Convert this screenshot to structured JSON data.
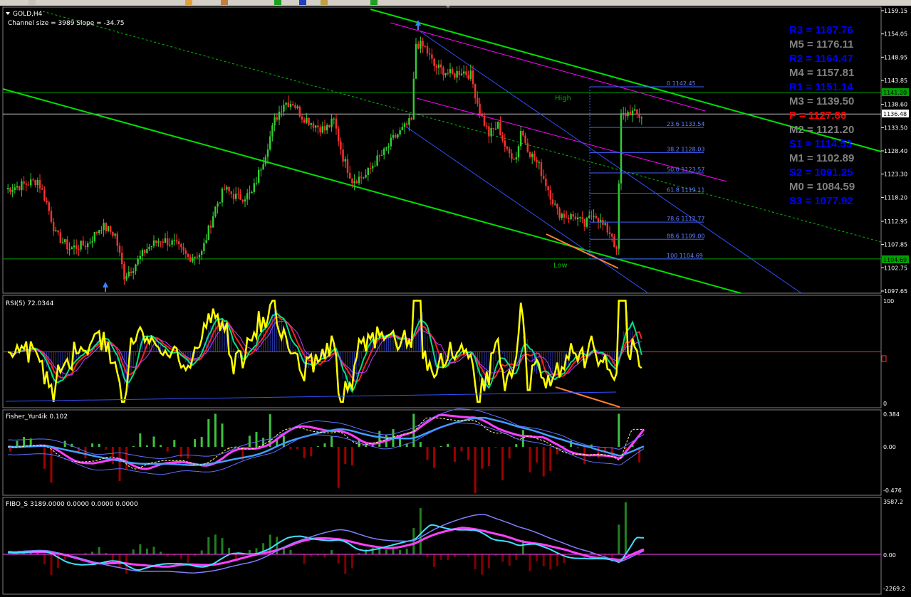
{
  "toolbar": {
    "buttons": [
      "tool-a",
      "tool-b",
      "tool-c",
      "tool-d",
      "tool-e",
      "tool-f",
      "tool-g"
    ]
  },
  "main": {
    "title": "GOLD,H4",
    "subtitle": "Channel size = 3989 Slope = -34.75",
    "price_labels": [
      "1159.15",
      "1154.05",
      "1148.95",
      "1143.85",
      "1138.60",
      "1133.50",
      "1128.40",
      "1123.30",
      "1118.20",
      "1112.95",
      "1107.85",
      "1102.75",
      "1097.65"
    ],
    "last_price": "1136.48",
    "high_price": "1141.20",
    "low_price": "1104.69",
    "high_label": "High",
    "low_label": "Low",
    "fib_levels": [
      {
        "label": "0 1142.45",
        "price": 1142.45
      },
      {
        "label": "23.6 1133.54",
        "price": 1133.54
      },
      {
        "label": "38.2 1128.03",
        "price": 1128.03
      },
      {
        "label": "50.0 1123.57",
        "price": 1123.57
      },
      {
        "label": "61.8 1119.11",
        "price": 1119.11
      },
      {
        "label": "78.6 1112.77",
        "price": 1112.77
      },
      {
        "label": "88.6 1109.00",
        "price": 1109.0
      },
      {
        "label": "100 1104.69",
        "price": 1104.69
      }
    ],
    "pivots": [
      {
        "label": "R3",
        "text": " = 1187.76",
        "color": "#0000ff"
      },
      {
        "label": "M5",
        "text": " = 1176.11",
        "color": "#808080"
      },
      {
        "label": "R2",
        "text": " = 1164.47",
        "color": "#0000ff"
      },
      {
        "label": "M4",
        "text": " = 1157.81",
        "color": "#808080"
      },
      {
        "label": "R1",
        "text": " = 1151.14",
        "color": "#0000ff"
      },
      {
        "label": "M3",
        "text": " = 1139.50",
        "color": "#808080"
      },
      {
        "label": "P",
        "text": "  = 1127.86",
        "color": "#ff0000"
      },
      {
        "label": "M2",
        "text": " = 1121.20",
        "color": "#808080"
      },
      {
        "label": "S1",
        "text": " = 1114.53",
        "color": "#0000ff"
      },
      {
        "label": "M1",
        "text": " = 1102.89",
        "color": "#808080"
      },
      {
        "label": "S2",
        "text": " = 1091.25",
        "color": "#0000ff"
      },
      {
        "label": "M0",
        "text": " = 1084.59",
        "color": "#808080"
      },
      {
        "label": "S3",
        "text": " = 1077.92",
        "color": "#0000ff"
      }
    ]
  },
  "rsi": {
    "title": "RSI(5) 72.0344",
    "labels": [
      "100",
      "0"
    ]
  },
  "fisher": {
    "title": "Fisher_Yur4ik 0.102",
    "labels": [
      "0.384",
      "0.00",
      "-0.476"
    ]
  },
  "fibo": {
    "title": "FIBO_S 3189.0000 0.0000 0.0000 0.0000",
    "labels": [
      "3587.2",
      "0.00",
      "-2269.2"
    ]
  },
  "colors": {
    "bull": "#32cd32",
    "bear": "#ff3030",
    "channel": "#00e000",
    "grid": "#ffffff",
    "rsi": "#ffff00"
  },
  "chart_data": {
    "type": "candlestick",
    "title": "GOLD,H4",
    "ylim": [
      1097.65,
      1159.15
    ],
    "series": [
      {
        "name": "RSI(5) 72.0344",
        "ylim": [
          0,
          100
        ]
      },
      {
        "name": "Fisher_Yur4ik 0.102",
        "ylim": [
          -0.476,
          0.384
        ]
      },
      {
        "name": "FIBO_S 3189.0000 0.0000 0.0000 0.0000",
        "ylim": [
          -2269.2,
          3587.2
        ]
      }
    ],
    "anchors": [
      [
        0,
        1120
      ],
      [
        8,
        1121
      ],
      [
        14,
        1122
      ],
      [
        18,
        1117
      ],
      [
        22,
        1110
      ],
      [
        28,
        1107
      ],
      [
        36,
        1108
      ],
      [
        42,
        1112
      ],
      [
        48,
        1110
      ],
      [
        52,
        1101
      ],
      [
        56,
        1103
      ],
      [
        62,
        1107
      ],
      [
        68,
        1109
      ],
      [
        74,
        1108
      ],
      [
        80,
        1105
      ],
      [
        86,
        1106
      ],
      [
        92,
        1116
      ],
      [
        96,
        1120
      ],
      [
        102,
        1118
      ],
      [
        108,
        1119
      ],
      [
        114,
        1128
      ],
      [
        118,
        1135
      ],
      [
        122,
        1139
      ],
      [
        126,
        1139
      ],
      [
        130,
        1136
      ],
      [
        136,
        1134
      ],
      [
        140,
        1133
      ],
      [
        144,
        1135
      ],
      [
        148,
        1127
      ],
      [
        152,
        1122
      ],
      [
        158,
        1123
      ],
      [
        162,
        1126
      ],
      [
        166,
        1128
      ],
      [
        170,
        1131
      ],
      [
        174,
        1133
      ],
      [
        178,
        1135
      ],
      [
        180,
        1152
      ],
      [
        184,
        1151
      ],
      [
        188,
        1147
      ],
      [
        192,
        1146
      ],
      [
        196,
        1145
      ],
      [
        200,
        1146
      ],
      [
        204,
        1145
      ],
      [
        208,
        1137
      ],
      [
        212,
        1132
      ],
      [
        216,
        1134
      ],
      [
        220,
        1128
      ],
      [
        224,
        1127
      ],
      [
        226,
        1133
      ],
      [
        230,
        1128
      ],
      [
        234,
        1125
      ],
      [
        238,
        1120
      ],
      [
        242,
        1115
      ],
      [
        246,
        1114
      ],
      [
        250,
        1114
      ],
      [
        254,
        1112
      ],
      [
        258,
        1115
      ],
      [
        262,
        1112
      ],
      [
        266,
        1110
      ],
      [
        268,
        1106
      ],
      [
        270,
        1136
      ],
      [
        274,
        1137
      ],
      [
        278,
        1136
      ]
    ]
  }
}
